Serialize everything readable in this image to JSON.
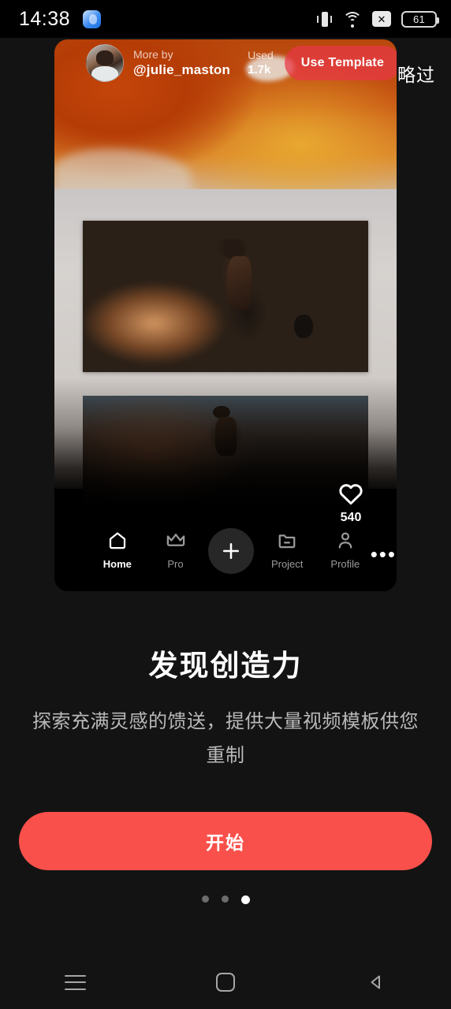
{
  "statusbar": {
    "time": "14:38",
    "app_icon": "messenger-icon",
    "icons": [
      "vibrate-icon",
      "wifi-icon",
      "no-signal-icon",
      "battery-icon"
    ],
    "battery_level": "61"
  },
  "skip": {
    "label": "略过"
  },
  "preview_card": {
    "header": {
      "avatar": "creator-avatar",
      "more_by_label": "More by",
      "username": "@julie_maston",
      "used_label": "Used",
      "used_count": "1.7k",
      "use_template_label": "Use Template"
    },
    "like": {
      "icon": "heart-icon",
      "count": "540"
    },
    "nav": [
      {
        "label": "Home",
        "icon": "home-icon",
        "active": true
      },
      {
        "label": "Pro",
        "icon": "crown-icon",
        "active": false
      },
      {
        "label": "",
        "icon": "plus-icon",
        "active": false
      },
      {
        "label": "Project",
        "icon": "folder-icon",
        "active": false
      },
      {
        "label": "Profile",
        "icon": "person-icon",
        "active": false
      }
    ],
    "overflow_label": "•••"
  },
  "onboarding": {
    "title": "发现创造力",
    "subtitle": "探索充满灵感的馈送，提供大量视频模板供您重制",
    "cta_label": "开始",
    "page_count": 3,
    "active_page": 3
  },
  "system_nav": {
    "recents": "menu-icon",
    "home": "home-square-icon",
    "back": "back-triangle-icon"
  },
  "colors": {
    "background": "#131313",
    "accent": "#fa504b",
    "use_template": "#e93846",
    "text_primary": "#ffffff",
    "text_secondary": "#b9b9b9"
  }
}
